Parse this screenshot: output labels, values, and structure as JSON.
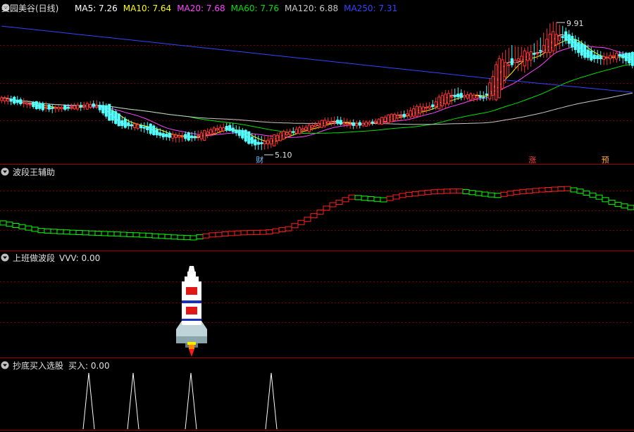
{
  "main_panel": {
    "stock_title": "奥园美谷(日线)",
    "ma_items": [
      {
        "label": "MA5: 7.26",
        "color": "#ffffff"
      },
      {
        "label": "MA10: 7.64",
        "color": "#ffff00"
      },
      {
        "label": "MA20: 7.68",
        "color": "#ff44ff"
      },
      {
        "label": "MA60: 7.76",
        "color": "#00e000"
      },
      {
        "label": "MA120: 6.88",
        "color": "#c8c8c8"
      },
      {
        "label": "MA250: 7.31",
        "color": "#3344ff"
      }
    ],
    "high_label": "9.91",
    "low_label": "5.10",
    "markers": [
      {
        "text": "财",
        "color": "#6cc0ff",
        "date_index": 82
      },
      {
        "text": "涨",
        "color": "#ff4444",
        "date_index": 168
      },
      {
        "text": "预",
        "color": "#ffaa33",
        "date_index": 191
      }
    ]
  },
  "bdw_panel": {
    "title": "波段王辅助"
  },
  "sbz_panel": {
    "title": "上班做波段",
    "value_label": "VVV: 0.00"
  },
  "cd_panel": {
    "title": "抄底买入选股",
    "value_label": "买入: 0.00"
  },
  "colors": {
    "up": "#ff3333",
    "down": "#54ffff",
    "bull": "#ff2020",
    "bear": "#00ff00",
    "separator": "#a00000",
    "grid": "#7a0000",
    "text": "#e0e0e0",
    "arrow_icon": "#c0c0c0"
  },
  "chart_data": [
    {
      "type": "candlestick",
      "title": "奥园美谷(日线)",
      "price_range": [
        5.1,
        9.91
      ],
      "candles_ohlc_sampled": [
        [
          6.95,
          7.1,
          6.85,
          7.05
        ],
        [
          7.05,
          7.12,
          6.8,
          6.85
        ],
        [
          6.85,
          6.92,
          6.7,
          6.8
        ],
        [
          6.8,
          6.9,
          6.55,
          6.62
        ],
        [
          6.62,
          6.75,
          6.5,
          6.7
        ],
        [
          6.7,
          6.8,
          6.6,
          6.65
        ],
        [
          6.65,
          6.85,
          6.6,
          6.8
        ],
        [
          6.8,
          6.95,
          6.7,
          6.75
        ],
        [
          6.75,
          6.8,
          6.2,
          6.25
        ],
        [
          6.25,
          6.35,
          5.9,
          5.95
        ],
        [
          5.95,
          6.1,
          5.85,
          6.05
        ],
        [
          6.05,
          6.1,
          5.7,
          5.75
        ],
        [
          5.75,
          5.85,
          5.5,
          5.55
        ],
        [
          5.55,
          5.7,
          5.4,
          5.65
        ],
        [
          5.65,
          5.75,
          5.45,
          5.5
        ],
        [
          5.5,
          5.8,
          5.45,
          5.75
        ],
        [
          5.75,
          6.0,
          5.7,
          5.95
        ],
        [
          5.95,
          6.1,
          5.8,
          5.85
        ],
        [
          5.85,
          5.9,
          5.45,
          5.5
        ],
        [
          5.5,
          5.6,
          5.1,
          5.2
        ],
        [
          5.2,
          5.6,
          5.15,
          5.55
        ],
        [
          5.55,
          5.8,
          5.5,
          5.75
        ],
        [
          5.75,
          5.95,
          5.7,
          5.85
        ],
        [
          5.85,
          6.05,
          5.8,
          6.0
        ],
        [
          6.0,
          6.25,
          5.95,
          6.2
        ],
        [
          6.2,
          6.35,
          6.05,
          6.1
        ],
        [
          6.1,
          6.2,
          5.9,
          6.0
        ],
        [
          6.0,
          6.15,
          5.95,
          6.1
        ],
        [
          6.1,
          6.25,
          6.05,
          6.2
        ],
        [
          6.2,
          6.45,
          6.15,
          6.4
        ],
        [
          6.4,
          6.55,
          6.3,
          6.35
        ],
        [
          6.35,
          6.8,
          6.3,
          6.75
        ],
        [
          6.75,
          6.9,
          6.6,
          6.7
        ],
        [
          6.7,
          7.3,
          6.65,
          7.25
        ],
        [
          7.25,
          7.4,
          7.0,
          7.05
        ],
        [
          7.05,
          7.2,
          6.95,
          7.15
        ],
        [
          7.15,
          7.3,
          6.95,
          7.0
        ],
        [
          7.0,
          8.6,
          6.95,
          8.5
        ],
        [
          8.5,
          9.0,
          8.2,
          8.3
        ],
        [
          8.3,
          8.9,
          8.0,
          8.8
        ],
        [
          8.8,
          9.2,
          8.6,
          8.7
        ],
        [
          8.7,
          9.91,
          8.6,
          9.6
        ],
        [
          9.6,
          9.7,
          9.1,
          9.2
        ],
        [
          9.2,
          9.3,
          8.6,
          8.7
        ],
        [
          8.7,
          8.9,
          8.4,
          8.5
        ],
        [
          8.5,
          8.7,
          8.3,
          8.6
        ],
        [
          8.6,
          8.8,
          8.45,
          8.7
        ],
        [
          8.7,
          8.75,
          8.2,
          8.3
        ]
      ]
    },
    {
      "type": "line",
      "title": "波段王辅助"
    },
    {
      "type": "line",
      "title": "上班做波段",
      "series": [
        {
          "name": "VVV",
          "values": [
            0.0
          ]
        }
      ]
    },
    {
      "type": "line",
      "title": "抄底买入选股",
      "series": [
        {
          "name": "买入",
          "values": [
            0.0
          ]
        }
      ],
      "spike_count": 4
    }
  ]
}
